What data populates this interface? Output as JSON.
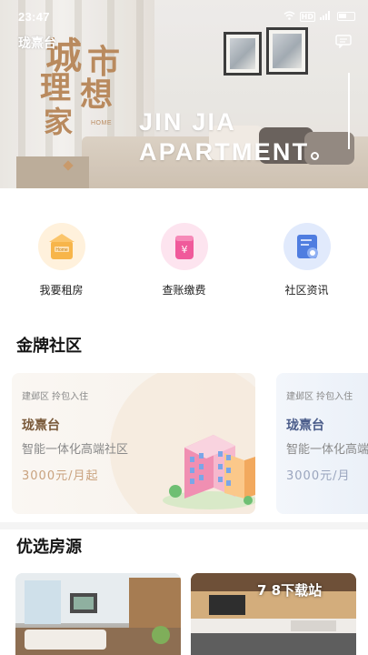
{
  "status_bar": {
    "time": "23:47",
    "network_label": "HD",
    "signal_text": "4G"
  },
  "header": {
    "location": "珑熹台"
  },
  "banner": {
    "calligraphy": [
      "城",
      "市",
      "理",
      "想",
      "家"
    ],
    "calligraphy_en": "HOME",
    "slogan_line1": "JIN JIA",
    "slogan_line2": "APARTMENT"
  },
  "quick_menu": [
    {
      "label": "我要租房",
      "icon": "home-box-icon",
      "color": "#f7b54a",
      "icon_text": "Home"
    },
    {
      "label": "查账缴费",
      "icon": "payment-wallet-icon",
      "color": "#f05a9b",
      "icon_text": "¥"
    },
    {
      "label": "社区资讯",
      "icon": "news-document-icon",
      "color": "#4f7de0",
      "icon_text": ""
    }
  ],
  "gold_section": {
    "title": "金牌社区",
    "cards": [
      {
        "tags": "建邺区  拎包入住",
        "name": "珑熹台",
        "description": "智能一体化高端社区",
        "price": "3000元/月起"
      },
      {
        "tags": "建邺区  拎包入住",
        "name": "珑熹台",
        "description": "智能一体化高端",
        "price": "3000元/月"
      }
    ]
  },
  "featured_section": {
    "title": "优选房源"
  },
  "watermark": "7 8下载站"
}
